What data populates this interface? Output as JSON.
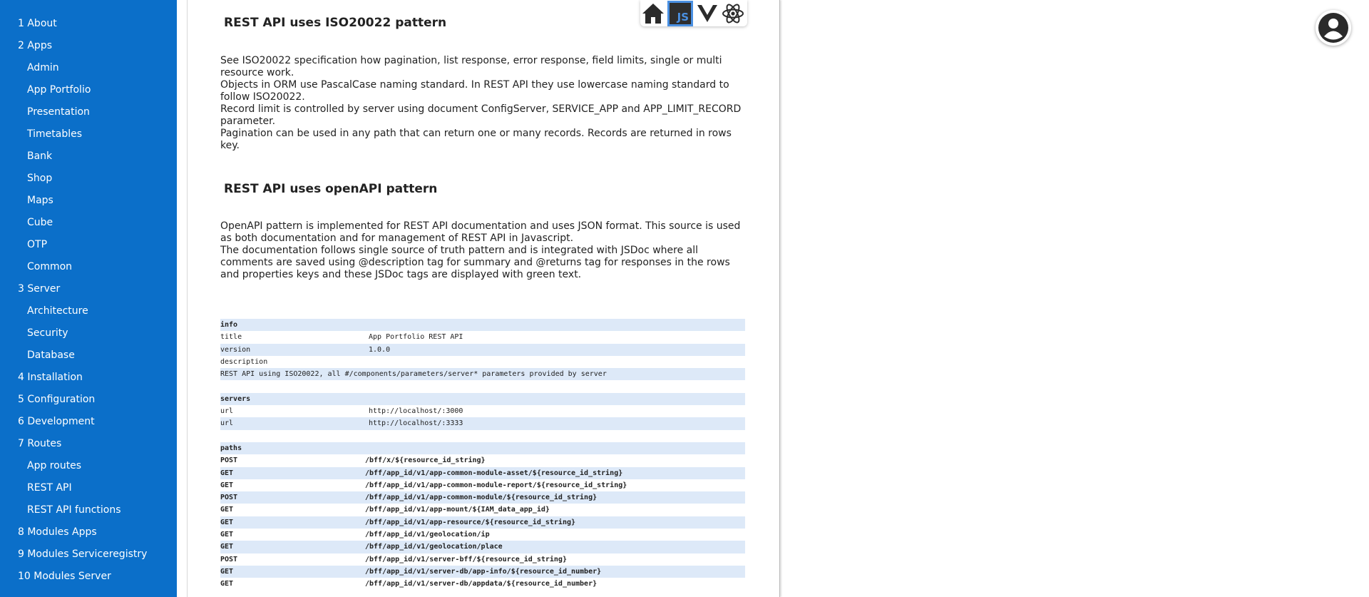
{
  "sidebar": {
    "items": [
      {
        "label": "1 About",
        "level": 0
      },
      {
        "label": "2 Apps",
        "level": 0
      },
      {
        "label": "Admin",
        "level": 1
      },
      {
        "label": "App Portfolio",
        "level": 1
      },
      {
        "label": "Presentation",
        "level": 1
      },
      {
        "label": "Timetables",
        "level": 1
      },
      {
        "label": "Bank",
        "level": 1
      },
      {
        "label": "Shop",
        "level": 1
      },
      {
        "label": "Maps",
        "level": 1
      },
      {
        "label": "Cube",
        "level": 1
      },
      {
        "label": "OTP",
        "level": 1
      },
      {
        "label": "Common",
        "level": 1
      },
      {
        "label": "3 Server",
        "level": 0
      },
      {
        "label": "Architecture",
        "level": 1
      },
      {
        "label": "Security",
        "level": 1
      },
      {
        "label": "Database",
        "level": 1
      },
      {
        "label": "4 Installation",
        "level": 0
      },
      {
        "label": "5 Configuration",
        "level": 0
      },
      {
        "label": "6 Development",
        "level": 0
      },
      {
        "label": "7 Routes",
        "level": 0
      },
      {
        "label": "App routes",
        "level": 1
      },
      {
        "label": "REST API",
        "level": 1
      },
      {
        "label": "REST API functions",
        "level": 1
      },
      {
        "label": "8 Modules Apps",
        "level": 0
      },
      {
        "label": "9 Modules Serviceregistry",
        "level": 0
      },
      {
        "label": "10 Modules Server",
        "level": 0
      }
    ]
  },
  "toolbar": {
    "icons": [
      "home-icon",
      "javascript-icon",
      "vue-icon",
      "react-icon"
    ],
    "js_label": "JS",
    "active": "javascript-icon",
    "active_color": "#4a90e2"
  },
  "document": {
    "section1": {
      "title": "REST API uses ISO20022 pattern",
      "paragraphs": [
        "See ISO20022 specification how pagination, list response, error response, field limits, single or multi resource work.",
        "Objects in ORM use PascalCase naming standard. In REST API they use lowercase naming standard to follow ISO20022.",
        "Record limit is controlled by server using document ConfigServer, SERVICE_APP and APP_LIMIT_RECORD parameter.",
        "Pagination can be used in any path that can return one or many records. Records are returned in rows key."
      ]
    },
    "section2": {
      "title": "REST API uses openAPI pattern",
      "paragraphs": [
        "OpenAPI pattern is implemented for REST API documentation and uses JSON format. This source is used as both documentation and for management of REST API in Javascript.",
        "The documentation follows single source of truth pattern and is integrated with JSDoc where all comments are saved using @description tag for summary and @returns tag for responses in the rows and properties keys and these JSDoc tags are displayed with green text."
      ]
    },
    "api_table": {
      "info_header": "info",
      "info_rows": [
        {
          "key": "title",
          "value": "App Portfolio REST API"
        },
        {
          "key": "version",
          "value": "1.0.0"
        },
        {
          "key": "description",
          "value": ""
        }
      ],
      "description_text": "REST API using ISO20022, all #/components/parameters/server* parameters provided by server",
      "servers_header": "servers",
      "servers_rows": [
        {
          "key": "url",
          "value": "http://localhost/:3000"
        },
        {
          "key": "url",
          "value": "http://localhost/:3333"
        }
      ],
      "paths_header": "paths",
      "paths_rows": [
        {
          "method": "POST",
          "path": "/bff/x/${resource_id_string}"
        },
        {
          "method": "GET",
          "path": "/bff/app_id/v1/app-common-module-asset/${resource_id_string}"
        },
        {
          "method": "GET",
          "path": "/bff/app_id/v1/app-common-module-report/${resource_id_string}"
        },
        {
          "method": "POST",
          "path": "/bff/app_id/v1/app-common-module/${resource_id_string}"
        },
        {
          "method": "GET",
          "path": "/bff/app_id/v1/app-mount/${IAM_data_app_id}"
        },
        {
          "method": "GET",
          "path": "/bff/app_id/v1/app-resource/${resource_id_string}"
        },
        {
          "method": "GET",
          "path": "/bff/app_id/v1/geolocation/ip"
        },
        {
          "method": "GET",
          "path": "/bff/app_id/v1/geolocation/place"
        },
        {
          "method": "POST",
          "path": "/bff/app_id/v1/server-bff/${resource_id_string}"
        },
        {
          "method": "GET",
          "path": "/bff/app_id/v1/server-db/app-info/${resource_id_number}"
        },
        {
          "method": "GET",
          "path": "/bff/app_id/v1/server-db/appdata/${resource_id_number}"
        }
      ]
    }
  },
  "avatar": {
    "icon": "user-icon"
  },
  "colors": {
    "sidebar_bg": "#0b6fc9",
    "row_shade": "#dde9f8"
  }
}
